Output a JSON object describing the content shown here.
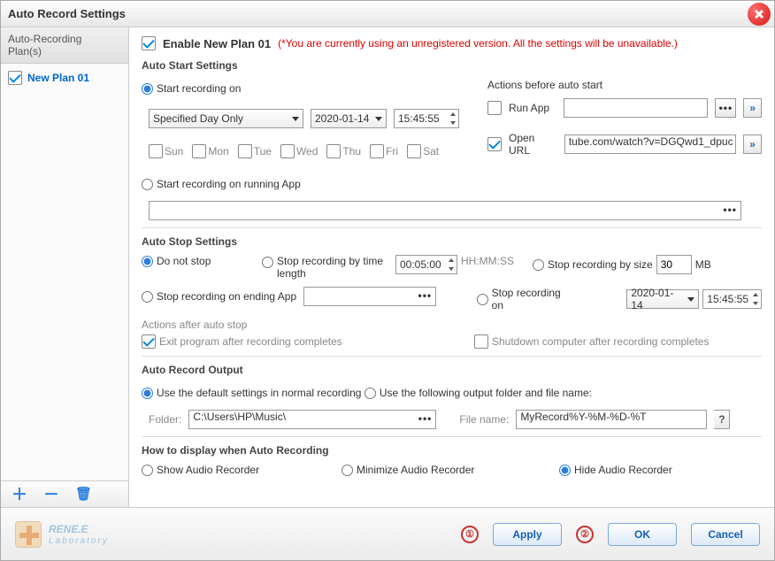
{
  "window": {
    "title": "Auto Record Settings"
  },
  "sidebar": {
    "heading_l1": "Auto-Recording",
    "heading_l2": "Plan(s)",
    "items": [
      {
        "label": "New Plan 01"
      }
    ]
  },
  "main": {
    "enable_label": "Enable New Plan 01",
    "warn": "(*You are currently using an unregistered version. All the settings will be unavailable.)",
    "auto_start": {
      "heading": "Auto Start Settings",
      "radio_start_on": "Start recording on",
      "schedule_mode": "Specified Day Only",
      "date": "2020-01-14",
      "time": "15:45:55",
      "days": [
        "Sun",
        "Mon",
        "Tue",
        "Wed",
        "Thu",
        "Fri",
        "Sat"
      ],
      "radio_start_app": "Start recording on running App",
      "actions_heading": "Actions before auto start",
      "run_app_label": "Run App",
      "open_url_label": "Open URL",
      "open_url_value": "tube.com/watch?v=DGQwd1_dpuc",
      "running_app_value": ""
    },
    "auto_stop": {
      "heading": "Auto Stop Settings",
      "radio_no_stop": "Do not stop",
      "radio_by_time_l1": "Stop recording by time",
      "radio_by_time_l2": "length",
      "time_value": "00:05:00",
      "time_unit": "HH:MM:SS",
      "radio_by_size": "Stop recording by size",
      "size_value": "30",
      "size_unit": "MB",
      "radio_on_app": "Stop recording on ending App",
      "app_value": "",
      "radio_stop_on": "Stop recording on",
      "stop_date": "2020-01-14",
      "stop_time": "15:45:55",
      "after_heading": "Actions after auto stop",
      "exit_label": "Exit program after recording completes",
      "shutdown_label": "Shutdown computer after recording completes"
    },
    "output": {
      "heading": "Auto Record Output",
      "radio_default": "Use the default settings in normal recording",
      "radio_custom": "Use the following output folder and file name:",
      "folder_label": "Folder:",
      "folder_value": "C:\\Users\\HP\\Music\\",
      "file_label": "File name:",
      "file_value": "MyRecord%Y-%M-%D-%T"
    },
    "display": {
      "heading": "How to display when Auto Recording",
      "opt_show": "Show Audio Recorder",
      "opt_min": "Minimize Audio Recorder",
      "opt_hide": "Hide Audio Recorder"
    }
  },
  "footer": {
    "brand_l1": "RENE.E",
    "brand_l2": "Laboratory",
    "marker1": "①",
    "marker2": "②",
    "apply": "Apply",
    "ok": "OK",
    "cancel": "Cancel"
  }
}
